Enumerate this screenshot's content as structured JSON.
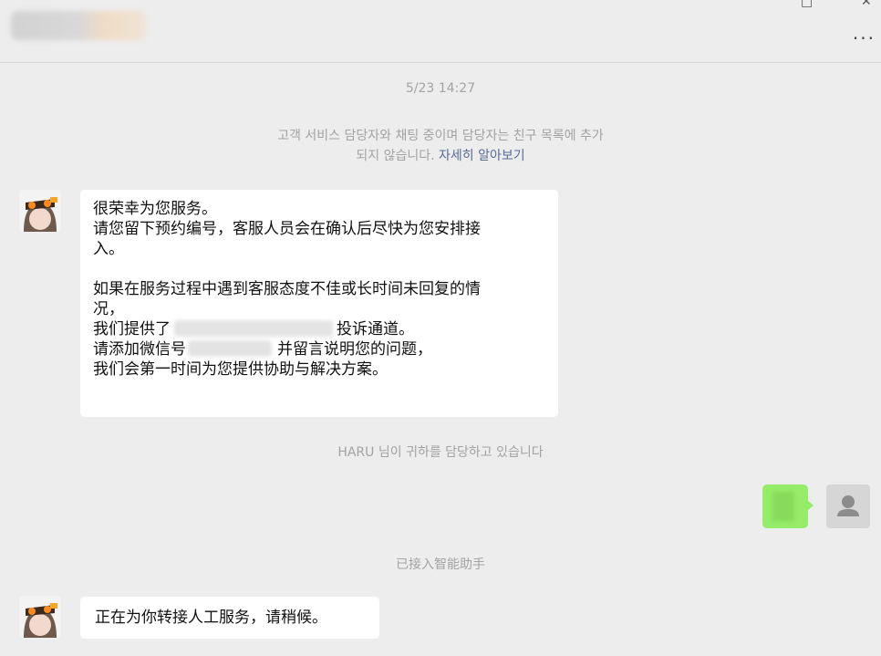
{
  "header": {
    "more_label": "..."
  },
  "chat": {
    "timestamp": "5/23 14:27",
    "notice_text": "고객 서비스 담당자와 채팅 중이며 담당자는 친구 목록에 추가",
    "notice_text2": "되지 않습니다.",
    "notice_link": "자세히 알아보기",
    "message1": {
      "line1": "很荣幸为您服务。",
      "line2": "请您留下预约编号，客服人员会在确认后尽快为您安排接",
      "line3": "入。",
      "line4": "如果在服务过程中遇到客服态度不佳或长时间未回复的情",
      "line5": "况，",
      "line6_prefix": "我们提供了",
      "line6_suffix": "投诉通道。",
      "line7_prefix": "请添加微信号",
      "line7_suffix": "并留言说明您的问题，",
      "line8": "我们会第一时间为您提供协助与解决方案。"
    },
    "agent_notice": "HARU 님이 귀하를 담당하고 있습니다",
    "assistant_notice": "已接入智能助手",
    "message2": "正在为你转接人工服务，请稍候。"
  },
  "colors": {
    "background": "#ededed",
    "bubble_self": "#95ec69",
    "link": "#576b95"
  }
}
